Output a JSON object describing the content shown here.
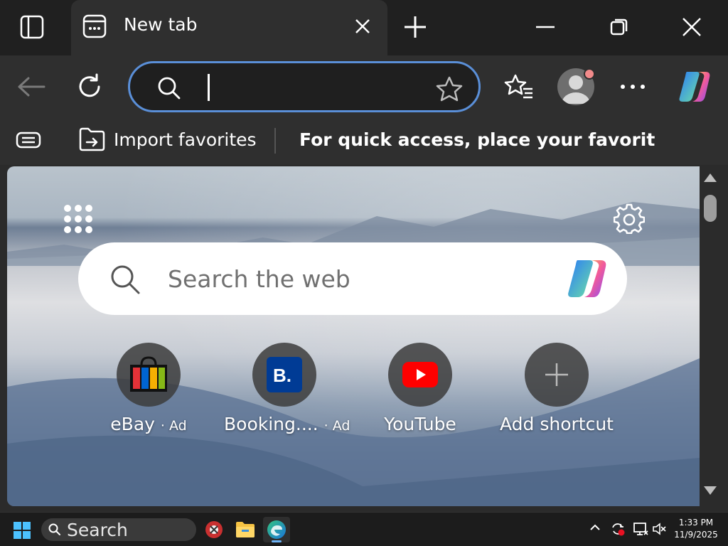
{
  "window": {
    "tab": {
      "title": "New tab"
    }
  },
  "toolbar": {
    "address": {
      "value": "",
      "placeholder": ""
    }
  },
  "favorites_bar": {
    "import_label": "Import favorites",
    "hint": "For quick access, place your favorites h..."
  },
  "new_tab_page": {
    "search_placeholder": "Search the web",
    "shortcuts": [
      {
        "name": "eBay",
        "ad": "· Ad"
      },
      {
        "name": "Booking....",
        "ad": "· Ad"
      },
      {
        "name": "YouTube",
        "ad": ""
      },
      {
        "name": "Add shortcut",
        "ad": ""
      }
    ]
  },
  "taskbar": {
    "search_label": "Search",
    "time": "1:33 PM",
    "date": "11/9/2025"
  },
  "colors": {
    "accent": "#5a8fd8",
    "youtube_red": "#ff0000",
    "booking_blue": "#003b95"
  }
}
